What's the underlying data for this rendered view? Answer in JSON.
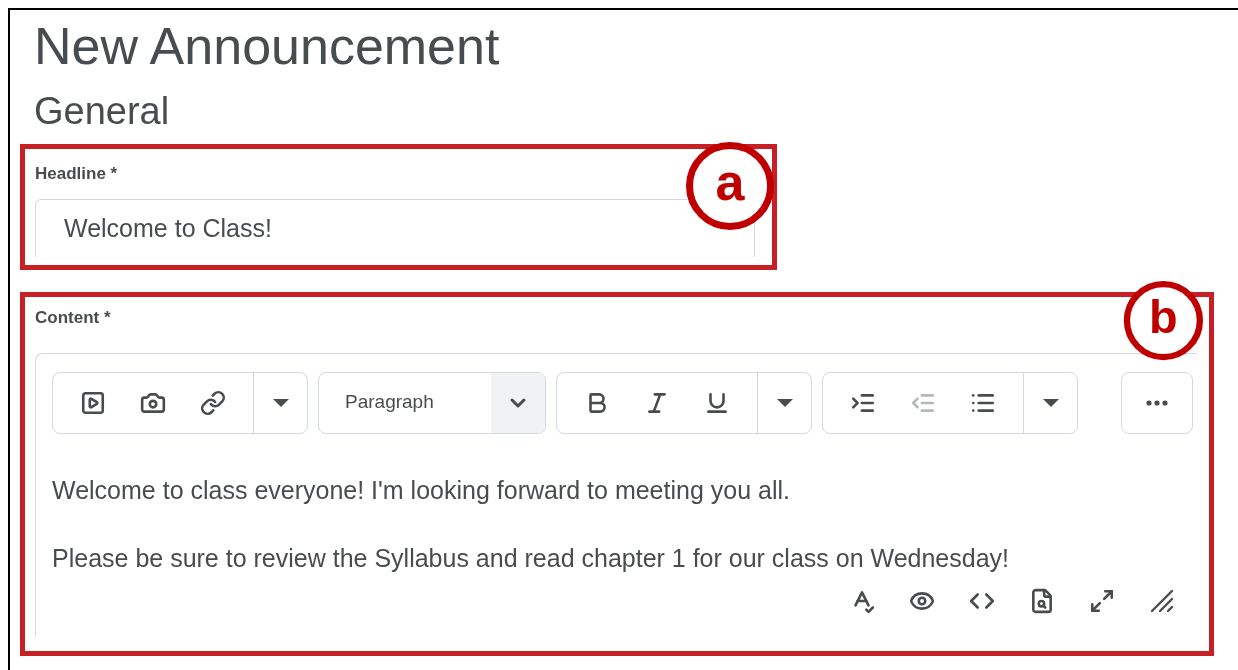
{
  "page": {
    "title": "New Announcement",
    "section": "General"
  },
  "headline": {
    "label": "Headline *",
    "value": "Welcome to Class!",
    "callout": "a"
  },
  "content": {
    "label": "Content *",
    "callout": "b",
    "format": "Paragraph",
    "toolbar_groups": [
      {
        "buttons": [
          {
            "kind": "video",
            "disabled": false
          },
          {
            "kind": "camera",
            "disabled": false
          },
          {
            "kind": "link",
            "disabled": false
          }
        ]
      },
      {
        "buttons": [
          {
            "kind": "bold",
            "disabled": false
          },
          {
            "kind": "italic",
            "disabled": false
          },
          {
            "kind": "underline",
            "disabled": false
          }
        ]
      },
      {
        "buttons": [
          {
            "kind": "indent",
            "disabled": false
          },
          {
            "kind": "outdent",
            "disabled": true
          },
          {
            "kind": "list",
            "disabled": false
          }
        ]
      }
    ],
    "paragraphs": [
      "Welcome to class everyone! I'm looking forward to meeting you all.",
      "Please be sure to review the Syllabus and read chapter 1 for our class on Wednesday!"
    ],
    "footer_tools": [
      {
        "kind": "spellcheck"
      },
      {
        "kind": "accessibility"
      },
      {
        "kind": "source"
      },
      {
        "kind": "preview"
      },
      {
        "kind": "fullscreen"
      },
      {
        "kind": "resize"
      }
    ]
  }
}
